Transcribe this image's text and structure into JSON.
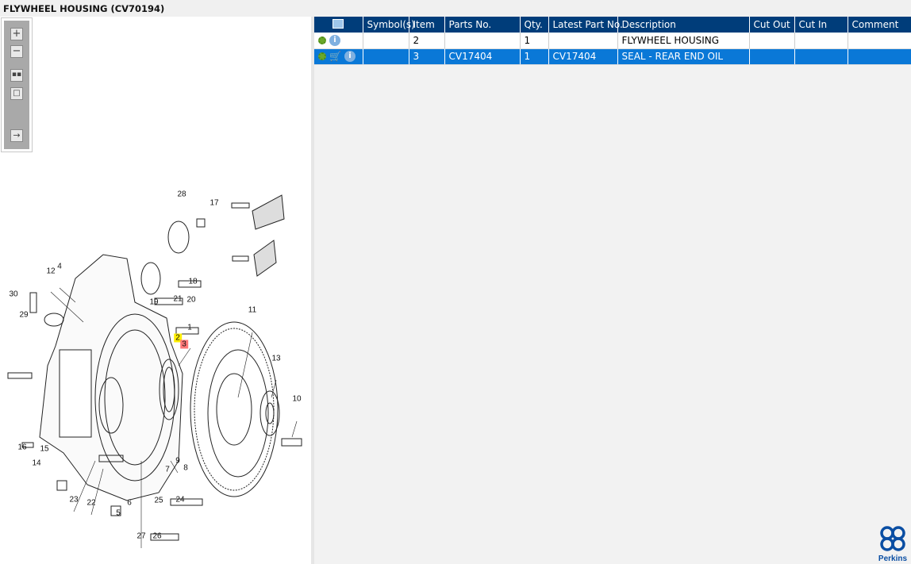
{
  "title": "FLYWHEEL HOUSING (CV70194)",
  "toolbar": {
    "buttons": [
      "zoom-in",
      "zoom-out",
      "fit-all",
      "fit-window",
      "toggle-list"
    ]
  },
  "table": {
    "columns": [
      "",
      "Symbol(s)",
      "Item",
      "Parts No.",
      "Qty.",
      "Latest Part No.",
      "Description",
      "Cut Out",
      "Cut In",
      "Comment"
    ],
    "rows": [
      {
        "icons": [
          "gear",
          "info"
        ],
        "symbols": "",
        "item": "2",
        "parts_no": "",
        "qty": "1",
        "latest": "",
        "description": "FLYWHEEL HOUSING",
        "cut_out": "",
        "cut_in": "",
        "comment": "",
        "selected": false
      },
      {
        "icons": [
          "gear",
          "cart",
          "info"
        ],
        "symbols": "",
        "item": "3",
        "parts_no": "CV17404",
        "qty": "1",
        "latest": "CV17404",
        "description": "SEAL - REAR END OIL",
        "cut_out": "",
        "cut_in": "",
        "comment": "",
        "selected": true
      }
    ]
  },
  "diagram": {
    "callouts": [
      "28",
      "17",
      "12",
      "4",
      "30",
      "29",
      "18",
      "19",
      "21",
      "20",
      "11",
      "1",
      "2",
      "3",
      "13",
      "10",
      "16",
      "15",
      "14",
      "9",
      "7",
      "8",
      "23",
      "22",
      "6",
      "5",
      "25",
      "24",
      "27",
      "26"
    ],
    "highlight_colors": {
      "2": "#ffee00",
      "3": "#ff7777"
    }
  },
  "logo": {
    "text": "Perkins",
    "color": "#0a4ea3"
  }
}
